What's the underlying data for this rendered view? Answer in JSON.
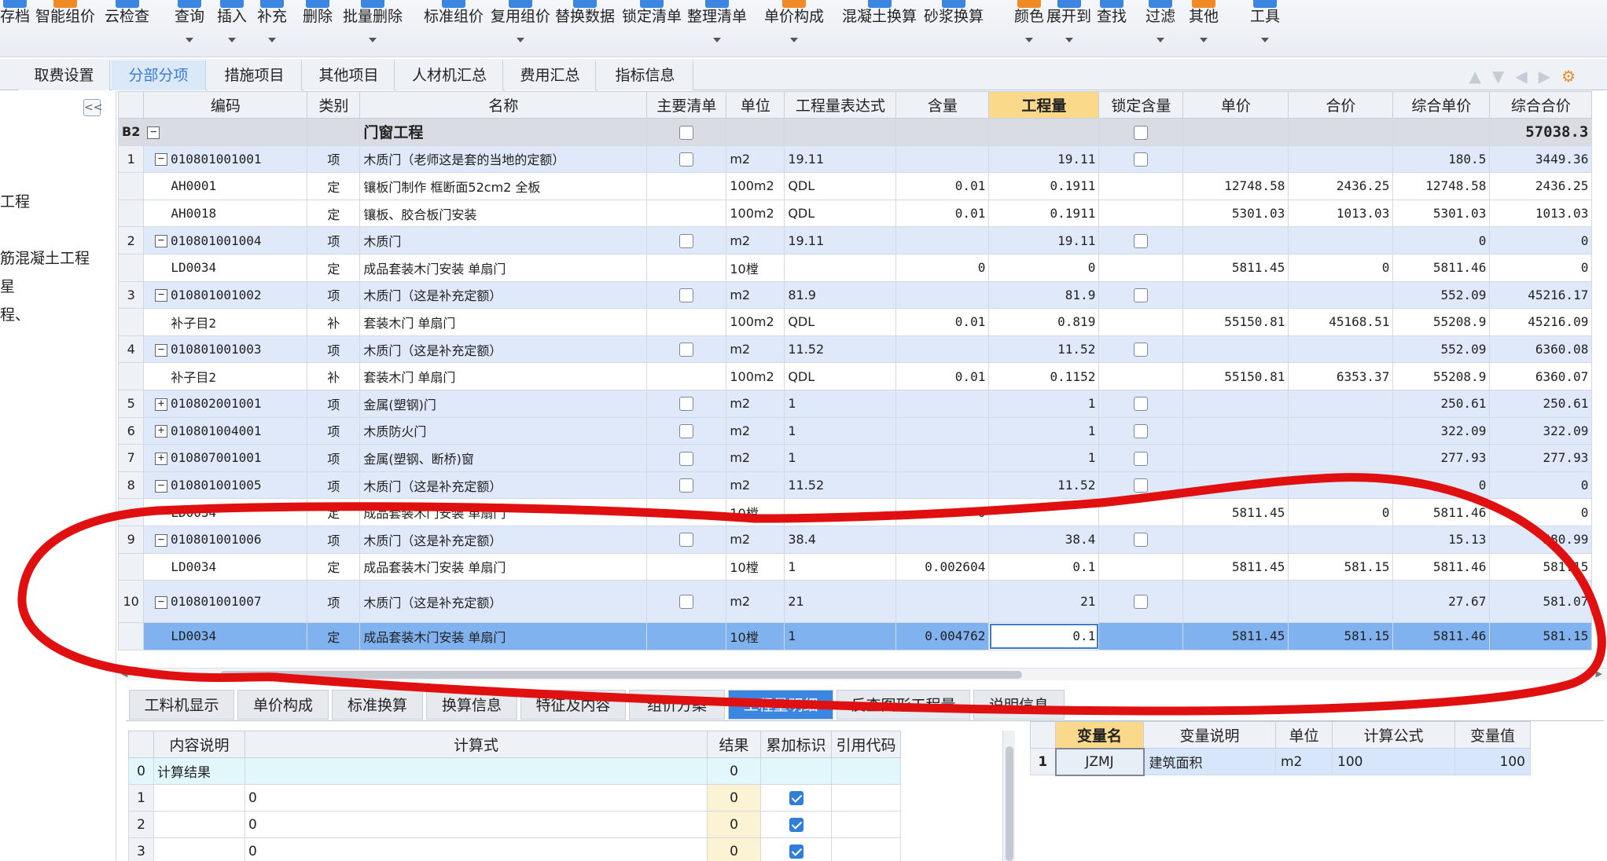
{
  "toolbar": {
    "buttons": [
      {
        "label": "存档",
        "icon": "save-icon"
      },
      {
        "label": "智能组价",
        "icon": "smart-pricing-icon"
      },
      {
        "label": "云检查",
        "icon": "cloud-check-icon"
      },
      {
        "label": "查询",
        "icon": "query-icon"
      },
      {
        "label": "插入",
        "icon": "insert-icon"
      },
      {
        "label": "补充",
        "icon": "supplement-icon"
      },
      {
        "label": "删除",
        "icon": "delete-icon"
      },
      {
        "label": "批量删除",
        "icon": "batch-delete-icon"
      },
      {
        "label": "标准组价",
        "icon": "standard-pricing-icon"
      },
      {
        "label": "复用组价",
        "icon": "reuse-pricing-icon"
      },
      {
        "label": "替换数据",
        "icon": "replace-data-icon"
      },
      {
        "label": "锁定清单",
        "icon": "lock-list-icon"
      },
      {
        "label": "整理清单",
        "icon": "organize-list-icon"
      },
      {
        "label": "单价构成",
        "icon": "unit-price-icon"
      },
      {
        "label": "混凝土换算",
        "icon": "concrete-convert-icon"
      },
      {
        "label": "砂浆换算",
        "icon": "mortar-convert-icon"
      },
      {
        "label": "颜色",
        "icon": "color-icon"
      },
      {
        "label": "展开到",
        "icon": "expand-to-icon"
      },
      {
        "label": "查找",
        "icon": "find-icon"
      },
      {
        "label": "过滤",
        "icon": "filter-icon"
      },
      {
        "label": "其他",
        "icon": "other-icon"
      },
      {
        "label": "工具",
        "icon": "tools-icon"
      }
    ]
  },
  "tabs": [
    "取费设置",
    "分部分项",
    "措施项目",
    "其他项目",
    "人材机汇总",
    "费用汇总",
    "指标信息"
  ],
  "active_tab": "分部分项",
  "left_panel": {
    "collapse_label": "<<",
    "items": [
      "工程",
      "筋混凝土工程",
      "星",
      "程、"
    ]
  },
  "grid": {
    "headers": [
      "编码",
      "类别",
      "名称",
      "主要清单",
      "单位",
      "工程量表达式",
      "含量",
      "工程量",
      "锁定含量",
      "单价",
      "合价",
      "综合单价",
      "综合合价"
    ],
    "rows": [
      {
        "rownum": "B2",
        "kind": "b2",
        "expander": "−",
        "code": "",
        "type": "",
        "name": "门窗工程",
        "main": "box",
        "unit": "",
        "expr": "",
        "content": "",
        "qty": "",
        "lock": "box",
        "uprice": "",
        "total": "",
        "cuprice": "",
        "ctotal": "57038.3"
      },
      {
        "rownum": "1",
        "kind": "item",
        "expander": "−",
        "code": "010801001001",
        "type": "项",
        "name": "木质门（老师这是套的当地的定额）",
        "main": "box",
        "unit": "m2",
        "expr": "19.11",
        "content": "",
        "qty": "19.11",
        "lock": "box",
        "uprice": "",
        "total": "",
        "cuprice": "180.5",
        "ctotal": "3449.36"
      },
      {
        "rownum": "",
        "kind": "sub",
        "expander": "",
        "code": "AH0001",
        "type": "定",
        "name": "镶板门制作 框断面52cm2 全板",
        "main": "",
        "unit": "100m2",
        "expr": "QDL",
        "content": "0.01",
        "qty": "0.1911",
        "lock": "",
        "uprice": "12748.58",
        "total": "2436.25",
        "cuprice": "12748.58",
        "ctotal": "2436.25"
      },
      {
        "rownum": "",
        "kind": "sub",
        "expander": "",
        "code": "AH0018",
        "type": "定",
        "name": "镶板、胶合板门安装",
        "main": "",
        "unit": "100m2",
        "expr": "QDL",
        "content": "0.01",
        "qty": "0.1911",
        "lock": "",
        "uprice": "5301.03",
        "total": "1013.03",
        "cuprice": "5301.03",
        "ctotal": "1013.03"
      },
      {
        "rownum": "2",
        "kind": "item",
        "expander": "−",
        "code": "010801001004",
        "type": "项",
        "name": "木质门",
        "main": "box",
        "unit": "m2",
        "expr": "19.11",
        "content": "",
        "qty": "19.11",
        "lock": "box",
        "uprice": "",
        "total": "",
        "cuprice": "0",
        "ctotal": "0"
      },
      {
        "rownum": "",
        "kind": "sub",
        "expander": "",
        "code": "LD0034",
        "type": "定",
        "name": "成品套装木门安装 单扇门",
        "main": "",
        "unit": "10樘",
        "expr": "",
        "content": "0",
        "qty": "0",
        "lock": "",
        "uprice": "5811.45",
        "total": "0",
        "cuprice": "5811.46",
        "ctotal": "0"
      },
      {
        "rownum": "3",
        "kind": "item",
        "expander": "−",
        "code": "010801001002",
        "type": "项",
        "name": "木质门（这是补充定额）",
        "main": "box",
        "unit": "m2",
        "expr": "81.9",
        "content": "",
        "qty": "81.9",
        "lock": "box",
        "uprice": "",
        "total": "",
        "cuprice": "552.09",
        "ctotal": "45216.17"
      },
      {
        "rownum": "",
        "kind": "sub",
        "expander": "",
        "code": "补子目2",
        "type": "补",
        "name": "套装木门 单扇门",
        "main": "",
        "unit": "100m2",
        "expr": "QDL",
        "content": "0.01",
        "qty": "0.819",
        "lock": "",
        "uprice": "55150.81",
        "total": "45168.51",
        "cuprice": "55208.9",
        "ctotal": "45216.09"
      },
      {
        "rownum": "4",
        "kind": "item",
        "expander": "−",
        "code": "010801001003",
        "type": "项",
        "name": "木质门（这是补充定额）",
        "main": "box",
        "unit": "m2",
        "expr": "11.52",
        "content": "",
        "qty": "11.52",
        "lock": "box",
        "uprice": "",
        "total": "",
        "cuprice": "552.09",
        "ctotal": "6360.08"
      },
      {
        "rownum": "",
        "kind": "sub",
        "expander": "",
        "code": "补子目2",
        "type": "补",
        "name": "套装木门 单扇门",
        "main": "",
        "unit": "100m2",
        "expr": "QDL",
        "content": "0.01",
        "qty": "0.1152",
        "lock": "",
        "uprice": "55150.81",
        "total": "6353.37",
        "cuprice": "55208.9",
        "ctotal": "6360.07"
      },
      {
        "rownum": "5",
        "kind": "item",
        "expander": "+",
        "code": "010802001001",
        "type": "项",
        "name": "金属(塑钢)门",
        "main": "box",
        "unit": "m2",
        "expr": "1",
        "content": "",
        "qty": "1",
        "lock": "box",
        "uprice": "",
        "total": "",
        "cuprice": "250.61",
        "ctotal": "250.61"
      },
      {
        "rownum": "6",
        "kind": "item",
        "expander": "+",
        "code": "010801004001",
        "type": "项",
        "name": "木质防火门",
        "main": "box",
        "unit": "m2",
        "expr": "1",
        "content": "",
        "qty": "1",
        "lock": "box",
        "uprice": "",
        "total": "",
        "cuprice": "322.09",
        "ctotal": "322.09"
      },
      {
        "rownum": "7",
        "kind": "item",
        "expander": "+",
        "code": "010807001001",
        "type": "项",
        "name": "金属(塑钢、断桥)窗",
        "main": "box",
        "unit": "m2",
        "expr": "1",
        "content": "",
        "qty": "1",
        "lock": "box",
        "uprice": "",
        "total": "",
        "cuprice": "277.93",
        "ctotal": "277.93"
      },
      {
        "rownum": "8",
        "kind": "item",
        "expander": "−",
        "code": "010801001005",
        "type": "项",
        "name": "木质门（这是补充定额）",
        "main": "box",
        "unit": "m2",
        "expr": "11.52",
        "content": "",
        "qty": "11.52",
        "lock": "box",
        "uprice": "",
        "total": "",
        "cuprice": "0",
        "ctotal": "0"
      },
      {
        "rownum": "",
        "kind": "sub",
        "expander": "",
        "code": "LD0034",
        "type": "定",
        "name": "成品套装木门安装 单扇门",
        "main": "",
        "unit": "10樘",
        "expr": "",
        "content": "0",
        "qty": "",
        "lock": "",
        "uprice": "5811.45",
        "total": "0",
        "cuprice": "5811.46",
        "ctotal": "0"
      },
      {
        "rownum": "9",
        "kind": "item",
        "expander": "−",
        "code": "010801001006",
        "type": "项",
        "name": "木质门（这是补充定额）",
        "main": "box",
        "unit": "m2",
        "expr": "38.4",
        "content": "",
        "qty": "38.4",
        "lock": "box",
        "uprice": "",
        "total": "",
        "cuprice": "15.13",
        "ctotal": "580.99"
      },
      {
        "rownum": "",
        "kind": "sub",
        "expander": "",
        "code": "LD0034",
        "type": "定",
        "name": "成品套装木门安装 单扇门",
        "main": "",
        "unit": "10樘",
        "expr": "1",
        "content": "0.002604",
        "qty": "0.1",
        "lock": "",
        "uprice": "5811.45",
        "total": "581.15",
        "cuprice": "5811.46",
        "ctotal": "581.15"
      },
      {
        "rownum": "10",
        "kind": "item-tall",
        "expander": "−",
        "code": "010801001007",
        "type": "项",
        "name": "木质门（这是补充定额）",
        "main": "box",
        "unit": "m2",
        "expr": "21",
        "content": "",
        "qty": "21",
        "lock": "box",
        "uprice": "",
        "total": "",
        "cuprice": "27.67",
        "ctotal": "581.07"
      },
      {
        "rownum": "",
        "kind": "sel",
        "expander": "",
        "code": "LD0034",
        "type": "定",
        "name": "成品套装木门安装 单扇门",
        "main": "",
        "unit": "10樘",
        "expr": "1",
        "content": "0.004762",
        "qty": "0.1",
        "lock": "",
        "uprice": "5811.45",
        "total": "581.15",
        "cuprice": "5811.46",
        "ctotal": "581.15"
      }
    ]
  },
  "bottom_tabs": [
    "工料机显示",
    "单价构成",
    "标准换算",
    "换算信息",
    "特征及内容",
    "组价方案",
    "工程量明细",
    "反查图形工程量",
    "说明信息"
  ],
  "bottom_active_tab": "工程量明细",
  "calc_table": {
    "headers": [
      "内容说明",
      "计算式",
      "结果",
      "累加标识",
      "引用代码"
    ],
    "rows": [
      {
        "rownum": "0",
        "desc": "计算结果",
        "formula": "",
        "result": "0",
        "checked": false
      },
      {
        "rownum": "1",
        "desc": "",
        "formula": "0",
        "result": "0",
        "checked": true
      },
      {
        "rownum": "2",
        "desc": "",
        "formula": "0",
        "result": "0",
        "checked": true
      },
      {
        "rownum": "3",
        "desc": "",
        "formula": "0",
        "result": "0",
        "checked": true
      }
    ]
  },
  "var_table": {
    "headers": [
      "变量名",
      "变量说明",
      "单位",
      "计算公式",
      "变量值"
    ],
    "rows": [
      {
        "rownum": "1",
        "name": "JZMJ",
        "desc": "建筑面积",
        "unit": "m2",
        "formula": "100",
        "value": "100"
      }
    ]
  },
  "colors": {
    "accent": "#3a86e0",
    "selected_row": "#7fb2ef",
    "header_highlight": "#fbd98a",
    "annotation": "#e01010"
  }
}
